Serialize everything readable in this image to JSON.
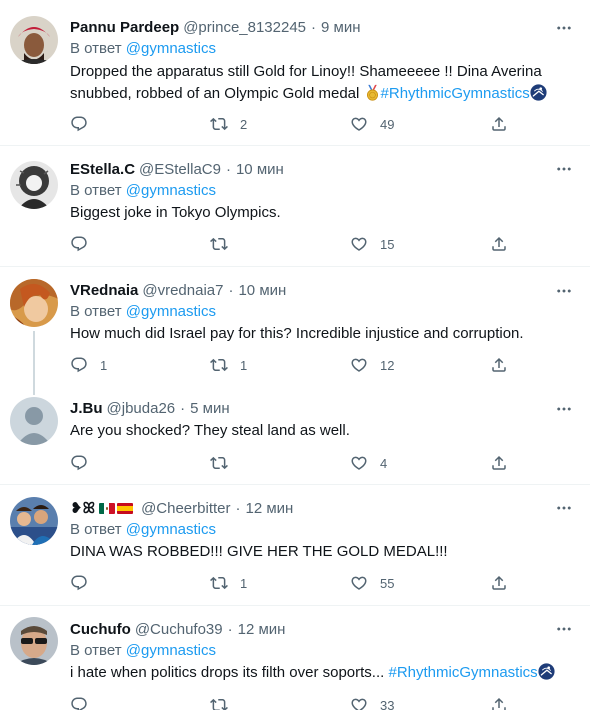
{
  "labels": {
    "replying_to": "В ответ"
  },
  "tweets": [
    {
      "name": "Pannu Pardeep",
      "handle": "@prince_8132245",
      "time": "9 мин",
      "reply_to": "@gymnastics",
      "text": "Dropped the apparatus still Gold for Linoy!! Shameeeee !! Dina Averina snubbed, robbed of an Olympic Gold medal",
      "hashtag": "#RhythmicGymnastics",
      "replies": "",
      "retweets": "2",
      "likes": "49"
    },
    {
      "name": "EStella.C",
      "handle": "@EStellaC9",
      "time": "10 мин",
      "reply_to": "@gymnastics",
      "text": "Biggest joke in Tokyo Olympics.",
      "replies": "",
      "retweets": "",
      "likes": "15"
    },
    {
      "name": "VRednaia",
      "handle": "@vrednaia7",
      "time": "10 мин",
      "reply_to": "@gymnastics",
      "text": "How much did Israel pay for this? Incredible injustice and corruption.",
      "replies": "1",
      "retweets": "1",
      "likes": "12"
    },
    {
      "name": "J.Bu",
      "handle": "@jbuda26",
      "time": "5 мин",
      "text": "Are you shocked? They steal land as well.",
      "replies": "",
      "retweets": "",
      "likes": "4"
    },
    {
      "name": "❥ꕤ",
      "handle": "@Cheerbitter",
      "time": "12 мин",
      "reply_to": "@gymnastics",
      "text": "DINA WAS ROBBED!!! GIVE HER THE GOLD MEDAL!!!",
      "replies": "",
      "retweets": "1",
      "likes": "55"
    },
    {
      "name": "Cuchufo",
      "handle": "@Cuchufo39",
      "time": "12 мин",
      "reply_to": "@gymnastics",
      "text": "i hate when politics drops its filth over soports...",
      "hashtag": "#RhythmicGymnastics",
      "replies": "",
      "retweets": "",
      "likes": "33"
    }
  ],
  "colors": {
    "accent": "#1d9bf0",
    "secondary_text": "#536471",
    "primary_text": "#0f1419",
    "divider": "#eff3f4",
    "thread_line": "#cfd9de"
  },
  "icons": [
    "more-icon",
    "reply-icon",
    "retweet-icon",
    "like-icon",
    "share-icon",
    "gold-medal-icon",
    "gymnastics-hashflag-icon",
    "mexico-flag-icon",
    "spain-flag-icon"
  ]
}
